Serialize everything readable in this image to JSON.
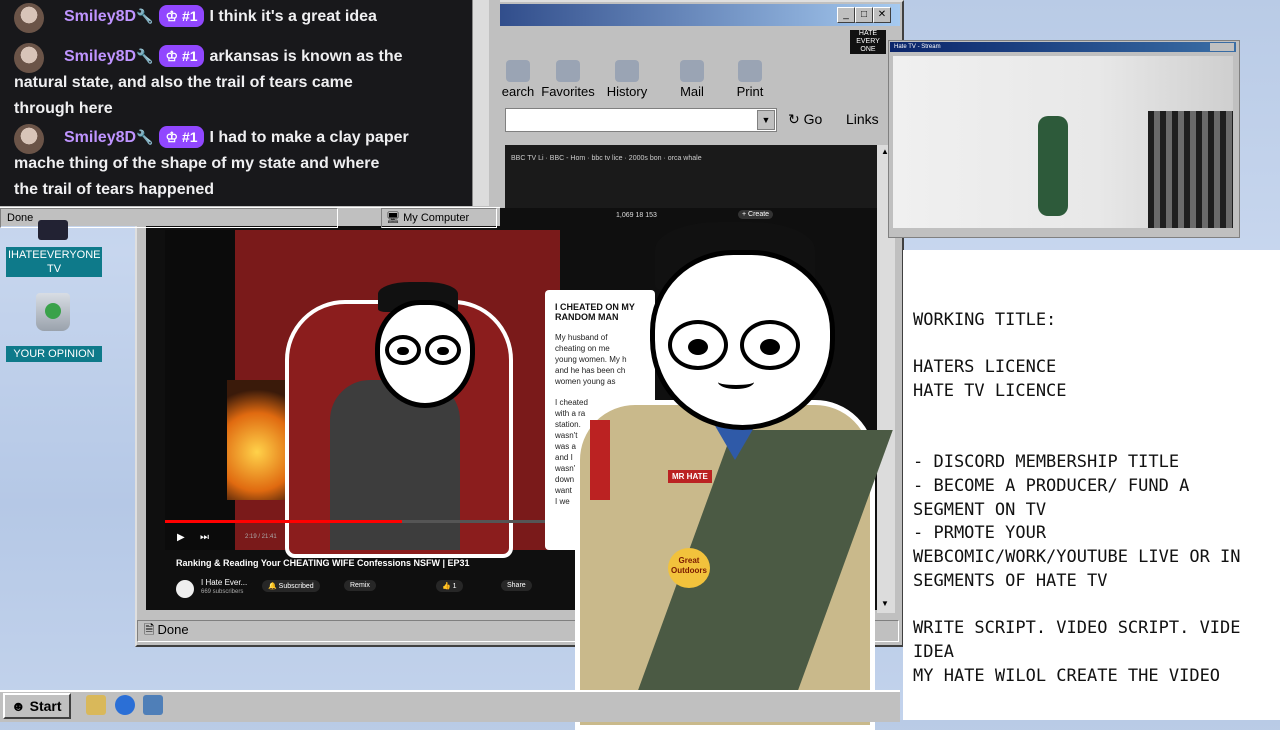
{
  "chat": {
    "messages": [
      {
        "user": "Smiley8D",
        "badge": "#1",
        "text": "I think it's a great idea"
      },
      {
        "user": "Smiley8D",
        "badge": "#1",
        "text": "arkansas is known as the",
        "text2": "natural state, and also the trail of tears came",
        "text3": "through here"
      },
      {
        "user": "Smiley8D",
        "badge": "#1",
        "text": "I had to make a clay paper",
        "text2": "mache thing of the shape of my state and where",
        "text3": "the trail of tears happened"
      }
    ],
    "status_left": "Done",
    "status_zone": "My Computer"
  },
  "browser": {
    "toolbar": [
      "earch",
      "Favorites",
      "History",
      "Mail",
      "Print"
    ],
    "go_label": "Go",
    "links_label": "Links",
    "status": "Done",
    "tabs": [
      "BBC TV Li",
      "BBC - Hom",
      "bbc tv lice",
      "2000s bon",
      "orca whale"
    ],
    "yt_stats": [
      "1,069",
      "18",
      "153"
    ],
    "create_label": "Create",
    "video_title": "Ranking & Reading Your CHEATING WIFE Confessions NSFW | EP31",
    "time": "2:19 / 21:41",
    "channel": "I Hate Ever...",
    "subs": "669 subscribers",
    "subscribed": "Subscribed",
    "remix": "Remix",
    "likes": "1",
    "share": "Share",
    "card_title": "I CHEATED ON MY RANDOM MAN",
    "card_text": [
      "My husband of",
      "cheating on me",
      "young women. My h",
      "and he has been ch",
      "women young as"
    ],
    "card_text2": [
      "I cheated",
      "with a ra",
      "station.",
      "wasn't",
      "was a",
      "and I",
      "wasn't",
      "down",
      "want",
      "I we"
    ]
  },
  "stream": {
    "title": "Hate TV - Stream"
  },
  "desktop": {
    "icons": [
      "IHATEEVERYONE TV",
      "YOUR OPINION"
    ]
  },
  "patches": [
    "MR HATE",
    "Great Outdoors"
  ],
  "notes": {
    "lines": [
      "WORKING TITLE:",
      "",
      "HATERS LICENCE",
      "HATE TV LICENCE",
      "",
      "",
      "- DISCORD MEMBERSHIP TITLE",
      "- BECOME A PRODUCER/ FUND A",
      "SEGMENT ON TV",
      "- PRMOTE YOUR",
      "WEBCOMIC/WORK/YOUTUBE LIVE OR IN",
      "SEGMENTS OF HATE TV",
      "",
      "WRITE SCRIPT. VIDEO SCRIPT. VIDE",
      "IDEA",
      "MY HATE WILOL CREATE THE VIDEO"
    ]
  },
  "taskbar": {
    "start": "Start"
  }
}
